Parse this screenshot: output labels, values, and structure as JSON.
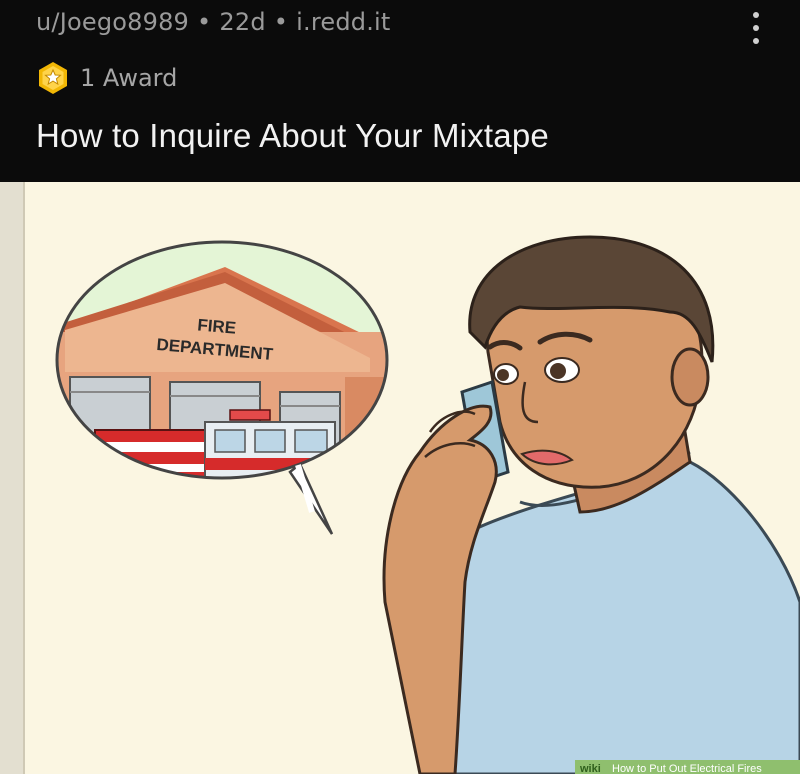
{
  "post": {
    "author": "u/Joego8989",
    "age": "22d",
    "domain": "i.redd.it",
    "separator": "•",
    "awards_label": "1 Award",
    "title": "How to Inquire About Your Mixtape"
  },
  "image": {
    "sign_line1": "FIRE",
    "sign_line2": "DEPARTMENT",
    "watermark": "How to Put Out Electrical Fires",
    "watermark_brand": "wiki"
  },
  "colors": {
    "background": "#0b0b0b",
    "meta_text": "#9a9a9a",
    "title_text": "#f2f2f2",
    "award_gold": "#f2b705",
    "illustration_bg": "#fbf6e2"
  }
}
